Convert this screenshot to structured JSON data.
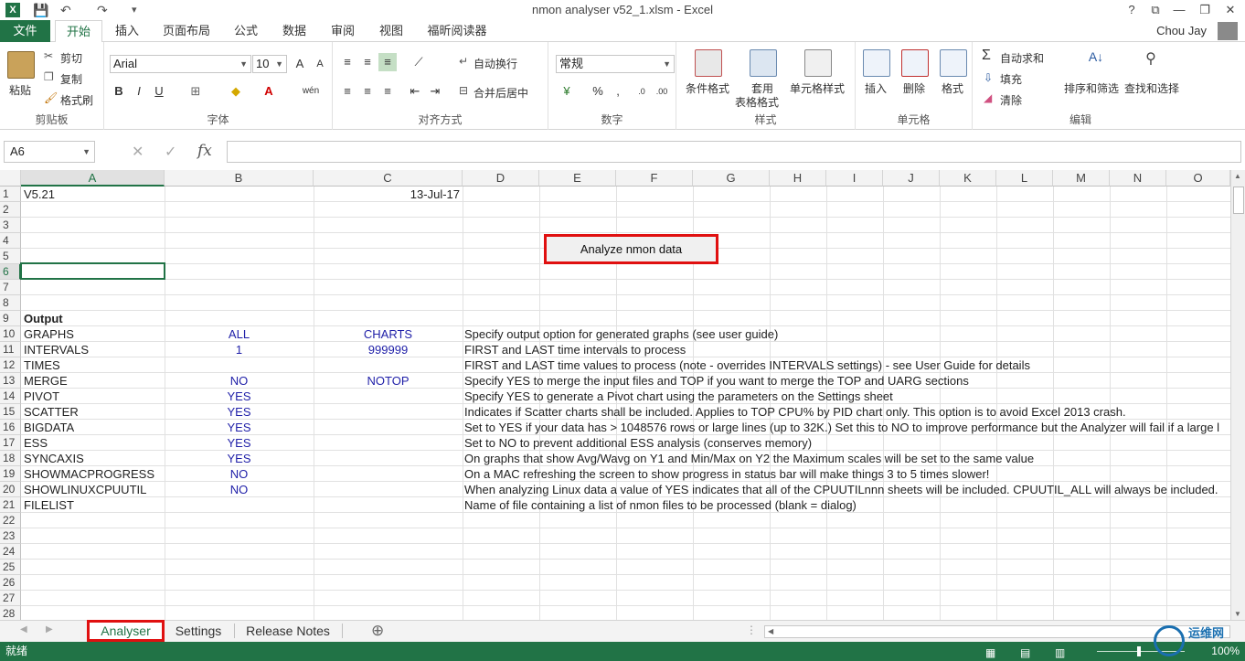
{
  "window": {
    "title": "nmon analyser v52_1.xlsm - Excel",
    "app_icon": "X",
    "help": "?",
    "ribbon_toggle": "⧉",
    "minimize": "—",
    "restore": "❐",
    "close": "✕"
  },
  "quick_access": {
    "save": "💾",
    "undo": "↶",
    "redo": "↷",
    "customize": "▾"
  },
  "tabs": [
    {
      "label": "文件"
    },
    {
      "label": "开始"
    },
    {
      "label": "插入"
    },
    {
      "label": "页面布局"
    },
    {
      "label": "公式"
    },
    {
      "label": "数据"
    },
    {
      "label": "审阅"
    },
    {
      "label": "视图"
    },
    {
      "label": "福昕阅读器"
    }
  ],
  "user": "Chou Jay",
  "ribbon": {
    "clipboard": {
      "paste": "粘贴",
      "cut": "剪切",
      "copy": "复制",
      "format_painter": "格式刷",
      "label": "剪贴板"
    },
    "font": {
      "name": "Arial",
      "size": "10",
      "grow": "A",
      "shrink": "A",
      "bold": "B",
      "italic": "I",
      "underline": "U",
      "phonetic": "wén",
      "label": "字体"
    },
    "alignment": {
      "wrap": "自动换行",
      "merge": "合并后居中",
      "label": "对齐方式"
    },
    "number": {
      "format": "常规",
      "percent": "%",
      "comma": ",",
      "label": "数字"
    },
    "styles": {
      "conditional": "条件格式",
      "table_line1": "套用",
      "table_line2": "表格格式",
      "cell_styles": "单元格样式",
      "label": "样式"
    },
    "cells": {
      "insert": "插入",
      "delete": "删除",
      "format": "格式",
      "label": "单元格"
    },
    "editing": {
      "autosum": "自动求和",
      "fill": "填充",
      "clear": "清除",
      "sort": "排序和筛选",
      "find": "查找和选择",
      "label": "编辑"
    }
  },
  "formula_bar": {
    "name_box": "A6",
    "fx": "fx",
    "cancel": "✕",
    "enter": "✓",
    "formula": ""
  },
  "columns": [
    "A",
    "B",
    "C",
    "D",
    "E",
    "F",
    "G",
    "H",
    "I",
    "J",
    "K",
    "L",
    "M",
    "N",
    "O"
  ],
  "rows": [
    "1",
    "2",
    "3",
    "4",
    "5",
    "6",
    "7",
    "8",
    "9",
    "10",
    "11",
    "12",
    "13",
    "14",
    "15",
    "16",
    "17",
    "18",
    "19",
    "20",
    "21",
    "22",
    "23",
    "24",
    "25",
    "26",
    "27",
    "28"
  ],
  "cells": {
    "r1": {
      "a": "V5.21",
      "c": "13-Jul-17"
    },
    "r9": {
      "a": "Output"
    },
    "r10": {
      "a": "GRAPHS",
      "b": "ALL",
      "c": "CHARTS",
      "d": "Specify output option for generated graphs (see user guide)"
    },
    "r11": {
      "a": "INTERVALS",
      "b": "1",
      "c": "999999",
      "d": "FIRST and LAST time intervals to process"
    },
    "r12": {
      "a": "TIMES",
      "d": "FIRST and LAST time values to process (note - overrides INTERVALS settings) - see User Guide for details"
    },
    "r13": {
      "a": "MERGE",
      "b": "NO",
      "c": "NOTOP",
      "d": "Specify YES to merge the input files and TOP if you want to merge the TOP and UARG sections"
    },
    "r14": {
      "a": "PIVOT",
      "b": "YES",
      "d": "Specify YES to generate a Pivot chart using the parameters on the Settings sheet"
    },
    "r15": {
      "a": "SCATTER",
      "b": "YES",
      "d": "Indicates if Scatter charts shall be included.  Applies to TOP CPU% by PID chart only.  This option is to avoid Excel 2013 crash."
    },
    "r16": {
      "a": "BIGDATA",
      "b": "YES",
      "d": "Set to YES if your data has > 1048576 rows or large lines (up to 32K.)  Set this to NO to improve performance but the Analyzer will fail if a large l"
    },
    "r17": {
      "a": "ESS",
      "b": "YES",
      "d": "Set to NO to prevent additional ESS analysis (conserves memory)"
    },
    "r18": {
      "a": "SYNCAXIS",
      "b": "YES",
      "d": "On graphs that show Avg/Wavg on Y1 and Min/Max on Y2 the Maximum scales will be set to the same value"
    },
    "r19": {
      "a": "SHOWMACPROGRESS",
      "b": "NO",
      "d": "On a MAC refreshing the screen to show progress in status bar will make things 3 to 5 times slower!"
    },
    "r20": {
      "a": "SHOWLINUXCPUUTIL",
      "b": "NO",
      "d": "When analyzing Linux data a value of YES indicates that all of the CPUUTILnnn sheets will be included.  CPUUTIL_ALL will always be included."
    },
    "r21": {
      "a": "FILELIST",
      "d": "Name of file containing a list of nmon files to be processed (blank = dialog)"
    }
  },
  "analyze_button": "Analyze nmon data",
  "sheets": [
    {
      "label": "Analyser"
    },
    {
      "label": "Settings"
    },
    {
      "label": "Release Notes"
    }
  ],
  "add_sheet": "⊕",
  "status": {
    "ready": "就绪",
    "zoom": "100%"
  },
  "watermark": "运维网"
}
